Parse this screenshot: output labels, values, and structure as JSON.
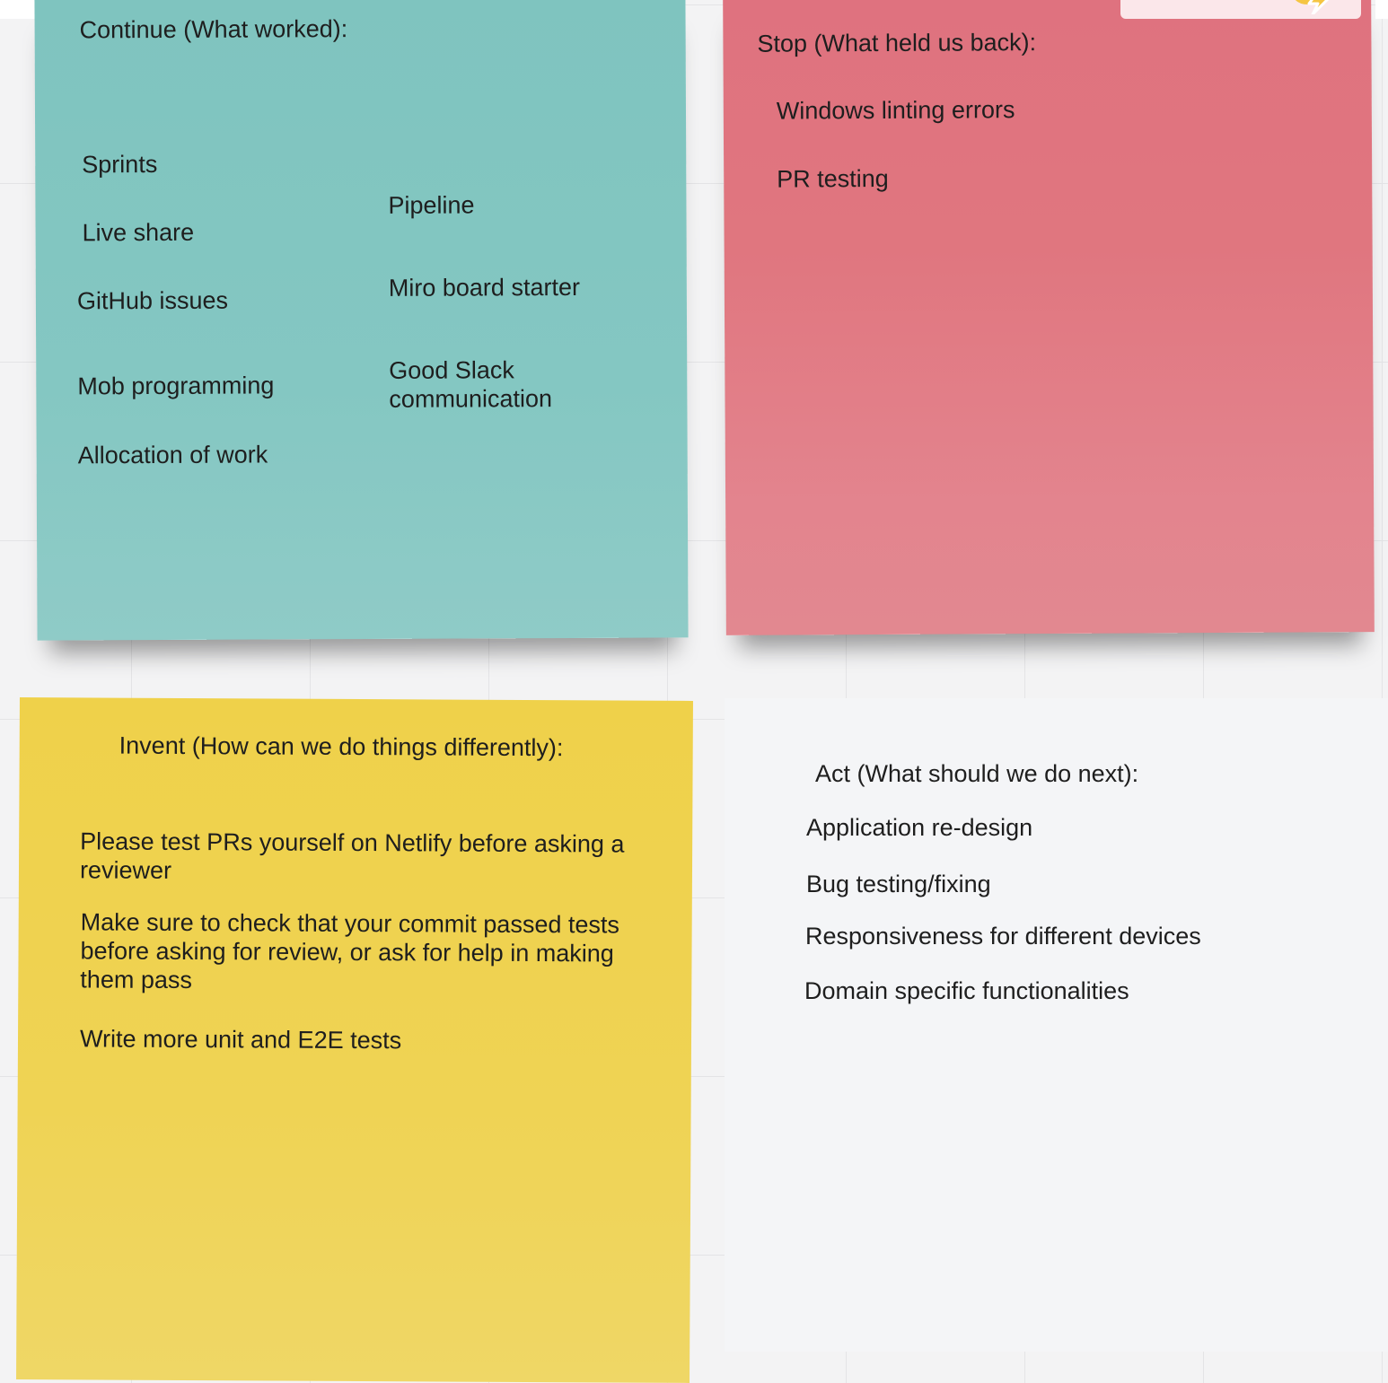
{
  "continue": {
    "heading": "Continue (What worked):",
    "items": [
      "Sprints",
      "Live share",
      "GitHub issues",
      "Mob programming",
      "Allocation of work",
      "Pipeline",
      "Miro board starter",
      "Good Slack communication"
    ]
  },
  "stop": {
    "heading": "Stop (What held us back):",
    "items": [
      "Windows linting errors",
      "PR testing"
    ]
  },
  "invent": {
    "heading": "Invent (How can we do things differently):",
    "items": [
      "Please test PRs yourself on Netlify before asking a reviewer",
      "Make sure to check that your commit passed tests before asking for review, or ask for help in making them pass",
      "Write more unit and E2E tests"
    ]
  },
  "act": {
    "heading": "Act (What should we do next):",
    "items": [
      "Application re-design",
      "Bug testing/fixing",
      "Responsiveness for different devices",
      "Domain specific functionalities"
    ]
  },
  "colors": {
    "continue_note": "#84c7c2",
    "stop_note": "#e0767f",
    "invent_note": "#efd354",
    "act_note": "#f4f5f7",
    "canvas": "#f3f3f4"
  },
  "icons": [
    "lightning-bolt-icon"
  ]
}
